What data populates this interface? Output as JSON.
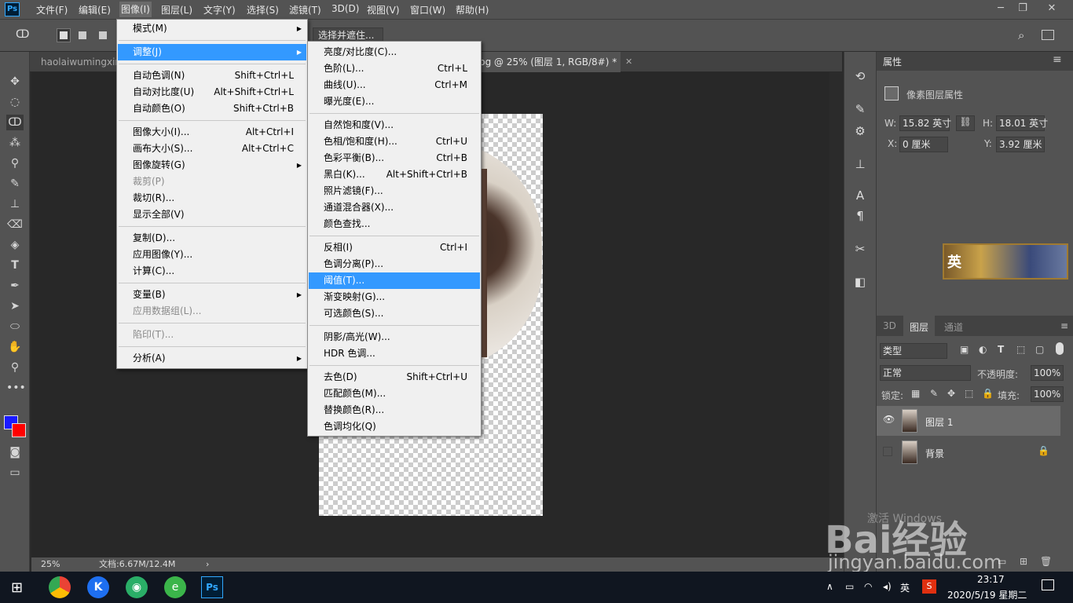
{
  "app": {
    "logo": "Ps"
  },
  "menubar": {
    "items": [
      "文件(F)",
      "编辑(E)",
      "图像(I)",
      "图层(L)",
      "文字(Y)",
      "选择(S)",
      "滤镜(T)",
      "3D(D)",
      "视图(V)",
      "窗口(W)",
      "帮助(H)"
    ],
    "window_controls": [
      "─",
      "❐",
      "✕"
    ]
  },
  "options_bar": {
    "select_mask_button": "选择并遮住..."
  },
  "tabs": [
    {
      "label": "haolaiwumingxing"
    },
    {
      "label": "pg @ 25% (图层 1, RGB/8#) *"
    }
  ],
  "status": {
    "zoom": "25%",
    "doc": "文档:6.67M/12.4M"
  },
  "image_menu": [
    {
      "label": "模式(M)",
      "arrow": true
    },
    {
      "sep": true
    },
    {
      "label": "调整(J)",
      "arrow": true,
      "hl": true
    },
    {
      "sep": true
    },
    {
      "label": "自动色调(N)",
      "sc": "Shift+Ctrl+L"
    },
    {
      "label": "自动对比度(U)",
      "sc": "Alt+Shift+Ctrl+L"
    },
    {
      "label": "自动颜色(O)",
      "sc": "Shift+Ctrl+B"
    },
    {
      "sep": true
    },
    {
      "label": "图像大小(I)...",
      "sc": "Alt+Ctrl+I"
    },
    {
      "label": "画布大小(S)...",
      "sc": "Alt+Ctrl+C"
    },
    {
      "label": "图像旋转(G)",
      "arrow": true
    },
    {
      "label": "裁剪(P)",
      "dis": true
    },
    {
      "label": "裁切(R)..."
    },
    {
      "label": "显示全部(V)"
    },
    {
      "sep": true
    },
    {
      "label": "复制(D)..."
    },
    {
      "label": "应用图像(Y)..."
    },
    {
      "label": "计算(C)..."
    },
    {
      "sep": true
    },
    {
      "label": "变量(B)",
      "arrow": true
    },
    {
      "label": "应用数据组(L)...",
      "dis": true
    },
    {
      "sep": true
    },
    {
      "label": "陷印(T)...",
      "dis": true
    },
    {
      "sep": true
    },
    {
      "label": "分析(A)",
      "arrow": true
    }
  ],
  "adjust_menu": [
    {
      "label": "亮度/对比度(C)..."
    },
    {
      "label": "色阶(L)...",
      "sc": "Ctrl+L"
    },
    {
      "label": "曲线(U)...",
      "sc": "Ctrl+M"
    },
    {
      "label": "曝光度(E)..."
    },
    {
      "sep": true
    },
    {
      "label": "自然饱和度(V)..."
    },
    {
      "label": "色相/饱和度(H)...",
      "sc": "Ctrl+U"
    },
    {
      "label": "色彩平衡(B)...",
      "sc": "Ctrl+B"
    },
    {
      "label": "黑白(K)...",
      "sc": "Alt+Shift+Ctrl+B"
    },
    {
      "label": "照片滤镜(F)..."
    },
    {
      "label": "通道混合器(X)..."
    },
    {
      "label": "颜色查找..."
    },
    {
      "sep": true
    },
    {
      "label": "反相(I)",
      "sc": "Ctrl+I"
    },
    {
      "label": "色调分离(P)..."
    },
    {
      "label": "阈值(T)...",
      "hl": true
    },
    {
      "label": "渐变映射(G)..."
    },
    {
      "label": "可选颜色(S)..."
    },
    {
      "sep": true
    },
    {
      "label": "阴影/高光(W)..."
    },
    {
      "label": "HDR 色调..."
    },
    {
      "sep": true
    },
    {
      "label": "去色(D)",
      "sc": "Shift+Ctrl+U"
    },
    {
      "label": "匹配颜色(M)..."
    },
    {
      "label": "替换颜色(R)..."
    },
    {
      "label": "色调均化(Q)"
    }
  ],
  "properties": {
    "title": "属性",
    "subtitle": "像素图层属性",
    "w_label": "W:",
    "w_value": "15.82 英寸",
    "h_label": "H:",
    "h_value": "18.01 英寸",
    "x_label": "X:",
    "x_value": "0 厘米",
    "y_label": "Y:",
    "y_value": "3.92 厘米"
  },
  "layers_panel": {
    "tabs": [
      "3D",
      "图层",
      "通道"
    ],
    "filter": "类型",
    "blend": "正常",
    "opacity_label": "不透明度:",
    "opacity": "100%",
    "lock_label": "锁定:",
    "fill_label": "填充:",
    "fill": "100%",
    "layers": [
      {
        "name": "图层 1"
      },
      {
        "name": "背景"
      }
    ]
  },
  "watermark": {
    "logo": "Bai经验",
    "url": "jingyan.baidu.com",
    "activate": "激活 Windows"
  },
  "ad": {
    "text": "英"
  },
  "taskbar": {
    "time": "23:17",
    "date": "2020/5/19 星期二",
    "ime": "英"
  }
}
